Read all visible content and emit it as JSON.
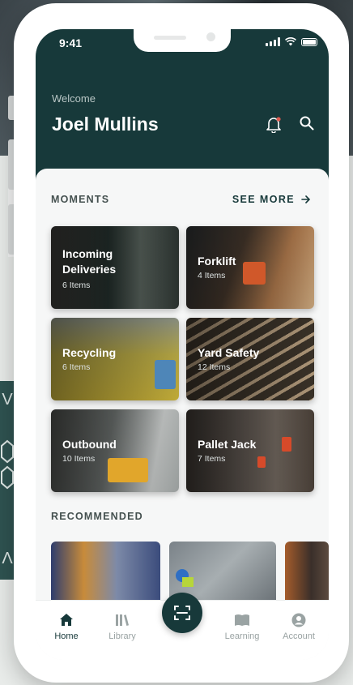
{
  "status_bar": {
    "time": "9:41"
  },
  "header": {
    "welcome": "Welcome",
    "user_name": "Joel Mullins"
  },
  "moments": {
    "title": "MOMENTS",
    "see_more": "SEE MORE",
    "cards": [
      {
        "title": "Incoming Deliveries",
        "count": "6 Items"
      },
      {
        "title": "Forklift",
        "count": "4 Items"
      },
      {
        "title": "Recycling",
        "count": "6 Items"
      },
      {
        "title": "Yard Safety",
        "count": "12 Items"
      },
      {
        "title": "Outbound",
        "count": "10 Items"
      },
      {
        "title": "Pallet Jack",
        "count": "7 Items"
      }
    ]
  },
  "recommended": {
    "title": "RECOMMENDED"
  },
  "tabbar": {
    "home": "Home",
    "library": "Library",
    "learning": "Learning",
    "account": "Account"
  },
  "background_glyphs": [
    "V",
    "Λ"
  ],
  "colors": {
    "primary": "#17393a",
    "inactive": "#9aa3a3"
  }
}
